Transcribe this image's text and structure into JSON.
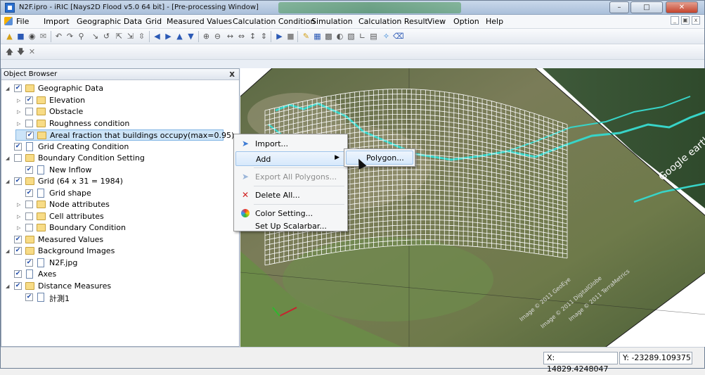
{
  "window": {
    "title": "N2F.ipro - iRIC [Nays2D Flood v5.0 64 bit] - [Pre-processing Window]",
    "controls": [
      "minimize",
      "maximize",
      "close"
    ]
  },
  "menubar": {
    "items": [
      "File",
      "Import",
      "Geographic Data",
      "Grid",
      "Measured Values",
      "Calculation Condition",
      "Simulation",
      "Calculation Result",
      "View",
      "Option",
      "Help"
    ],
    "mdi_buttons": [
      "_",
      "ฅ",
      "x"
    ]
  },
  "toolbar": {
    "icons": [
      "open-icon",
      "save-icon",
      "snapshot-icon",
      "mail-icon",
      "undo-icon",
      "redo-icon",
      "zoom-icon",
      "axis-xy-icon",
      "axis-rotate-icon",
      "axis-x-icon",
      "axis-y-icon",
      "axis-z-icon",
      "arrow-left-icon",
      "arrow-right-icon",
      "arrow-up-icon",
      "arrow-down-icon",
      "zoom-in-icon",
      "zoom-out-icon",
      "move-h-icon",
      "move-hh-icon",
      "move-v-icon",
      "move-vv-icon",
      "play-icon",
      "stop-icon",
      "edit-icon",
      "grid-icon",
      "grid2-icon",
      "grid3-icon",
      "grid4-icon",
      "graph-icon",
      "chart-icon",
      "iric-icon",
      "clip-icon"
    ],
    "row2_icons": [
      "move-up-icon",
      "move-down-icon",
      "delete-icon"
    ]
  },
  "object_browser": {
    "title": "Object Browser",
    "close": "x",
    "tree": [
      {
        "label": "Geographic Data",
        "level": 0,
        "expanded": true,
        "checked": true,
        "icon": "folder"
      },
      {
        "label": "Elevation",
        "level": 1,
        "expanded": false,
        "checked": true,
        "icon": "folder"
      },
      {
        "label": "Obstacle",
        "level": 1,
        "expanded": false,
        "checked": false,
        "icon": "folder"
      },
      {
        "label": "Roughness condition",
        "level": 1,
        "expanded": false,
        "checked": false,
        "icon": "folder"
      },
      {
        "label": "Areal fraction that buildings occupy(max=0.95)",
        "level": 1,
        "expanded": null,
        "checked": true,
        "icon": "folder",
        "selected": true
      },
      {
        "label": "Grid Creating Condition",
        "level": 0,
        "expanded": null,
        "checked": true,
        "icon": "file"
      },
      {
        "label": "Boundary Condition Setting",
        "level": 0,
        "expanded": true,
        "checked": false,
        "icon": "folder"
      },
      {
        "label": "New Inflow",
        "level": 1,
        "expanded": null,
        "checked": true,
        "icon": "file"
      },
      {
        "label": "Grid (64 x 31 = 1984)",
        "level": 0,
        "expanded": true,
        "checked": true,
        "icon": "folder"
      },
      {
        "label": "Grid shape",
        "level": 1,
        "expanded": null,
        "checked": true,
        "icon": "file"
      },
      {
        "label": "Node attributes",
        "level": 1,
        "expanded": false,
        "checked": false,
        "icon": "folder"
      },
      {
        "label": "Cell attributes",
        "level": 1,
        "expanded": false,
        "checked": false,
        "icon": "folder"
      },
      {
        "label": "Boundary Condition",
        "level": 1,
        "expanded": false,
        "checked": false,
        "icon": "folder"
      },
      {
        "label": "Measured Values",
        "level": 0,
        "expanded": null,
        "checked": true,
        "icon": "folder"
      },
      {
        "label": "Background Images",
        "level": 0,
        "expanded": true,
        "checked": true,
        "icon": "folder"
      },
      {
        "label": "N2F.jpg",
        "level": 1,
        "expanded": null,
        "checked": true,
        "icon": "file"
      },
      {
        "label": "Axes",
        "level": 0,
        "expanded": null,
        "checked": true,
        "icon": "file"
      },
      {
        "label": "Distance Measures",
        "level": 0,
        "expanded": true,
        "checked": true,
        "icon": "folder"
      },
      {
        "label": "計測1",
        "level": 1,
        "expanded": null,
        "checked": true,
        "icon": "file"
      }
    ]
  },
  "context_menu": {
    "items": [
      {
        "label": "Import...",
        "icon": "import-icon",
        "enabled": true
      },
      {
        "label": "Add",
        "icon": "",
        "enabled": true,
        "submenu": true,
        "highlighted": true
      },
      {
        "label": "Export All Polygons...",
        "icon": "export-icon",
        "enabled": false
      },
      {
        "label": "Delete All...",
        "icon": "delete-icon",
        "enabled": true
      },
      {
        "label": "Color Setting...",
        "icon": "color-icon",
        "enabled": true
      },
      {
        "label": "Set Up Scalarbar...",
        "icon": "",
        "enabled": true
      }
    ],
    "submenu_items": [
      "Polygon..."
    ]
  },
  "map": {
    "watermark": "Google earth",
    "credits": [
      "Image © 2011 GeoEye",
      "Image © 2011 DigitalGlobe",
      "Image © 2011 TerraMetrics"
    ]
  },
  "statusbar": {
    "x": "X: 14829.4248047",
    "y": "Y: -23289.109375"
  }
}
